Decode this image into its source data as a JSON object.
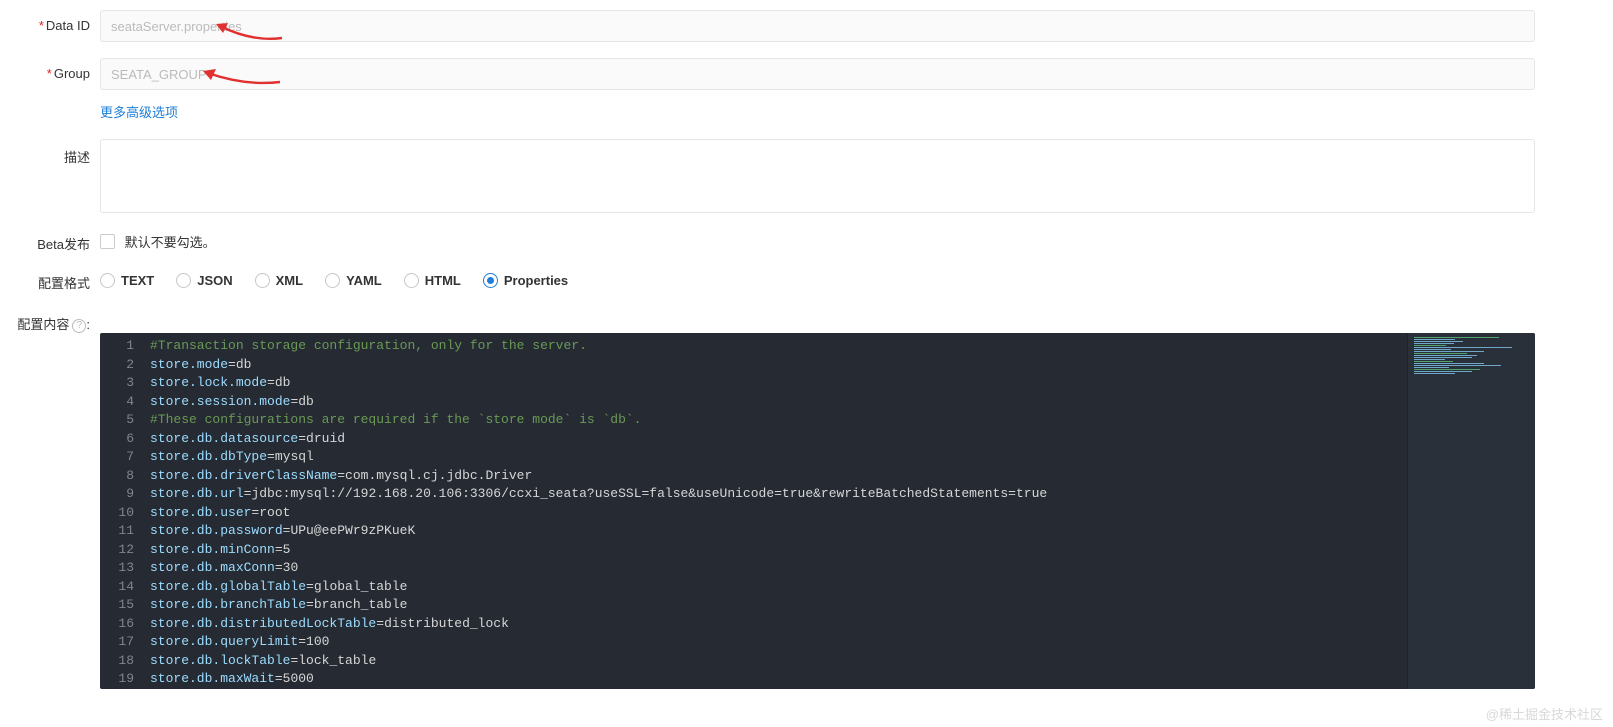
{
  "form": {
    "dataId": {
      "label": "Data ID",
      "value": "seataServer.properties"
    },
    "group": {
      "label": "Group",
      "value": "SEATA_GROUP"
    },
    "advanced_link": "更多高级选项",
    "desc": {
      "label": "描述",
      "value": ""
    },
    "beta": {
      "label": "Beta发布",
      "hint": "默认不要勾选。"
    },
    "format": {
      "label": "配置格式",
      "options": [
        "TEXT",
        "JSON",
        "XML",
        "YAML",
        "HTML",
        "Properties"
      ],
      "selected": "Properties"
    },
    "content_label": "配置内容",
    "help_glyph": "?"
  },
  "editor": {
    "lines": [
      {
        "n": 1,
        "type": "comment",
        "text": "#Transaction storage configuration, only for the server."
      },
      {
        "n": 2,
        "type": "kv",
        "k": "store.mode",
        "v": "db"
      },
      {
        "n": 3,
        "type": "kv",
        "k": "store.lock.mode",
        "v": "db"
      },
      {
        "n": 4,
        "type": "kv",
        "k": "store.session.mode",
        "v": "db"
      },
      {
        "n": 5,
        "type": "comment",
        "text": "#These configurations are required if the `store mode` is `db`."
      },
      {
        "n": 6,
        "type": "kv",
        "k": "store.db.datasource",
        "v": "druid"
      },
      {
        "n": 7,
        "type": "kv",
        "k": "store.db.dbType",
        "v": "mysql"
      },
      {
        "n": 8,
        "type": "kv",
        "k": "store.db.driverClassName",
        "v": "com.mysql.cj.jdbc.Driver"
      },
      {
        "n": 9,
        "type": "kv",
        "k": "store.db.url",
        "v": "jdbc:mysql://192.168.20.106:3306/ccxi_seata?useSSL=false&useUnicode=true&rewriteBatchedStatements=true"
      },
      {
        "n": 10,
        "type": "kv",
        "k": "store.db.user",
        "v": "root"
      },
      {
        "n": 11,
        "type": "kv",
        "k": "store.db.password",
        "v": "UPu@eePWr9zPKueK"
      },
      {
        "n": 12,
        "type": "kv",
        "k": "store.db.minConn",
        "v": "5"
      },
      {
        "n": 13,
        "type": "kv",
        "k": "store.db.maxConn",
        "v": "30"
      },
      {
        "n": 14,
        "type": "kv",
        "k": "store.db.globalTable",
        "v": "global_table"
      },
      {
        "n": 15,
        "type": "kv",
        "k": "store.db.branchTable",
        "v": "branch_table"
      },
      {
        "n": 16,
        "type": "kv",
        "k": "store.db.distributedLockTable",
        "v": "distributed_lock"
      },
      {
        "n": 17,
        "type": "kv",
        "k": "store.db.queryLimit",
        "v": "100"
      },
      {
        "n": 18,
        "type": "kv",
        "k": "store.db.lockTable",
        "v": "lock_table"
      },
      {
        "n": 19,
        "type": "kv",
        "k": "store.db.maxWait",
        "v": "5000"
      }
    ]
  },
  "watermark": "@稀土掘金技术社区"
}
